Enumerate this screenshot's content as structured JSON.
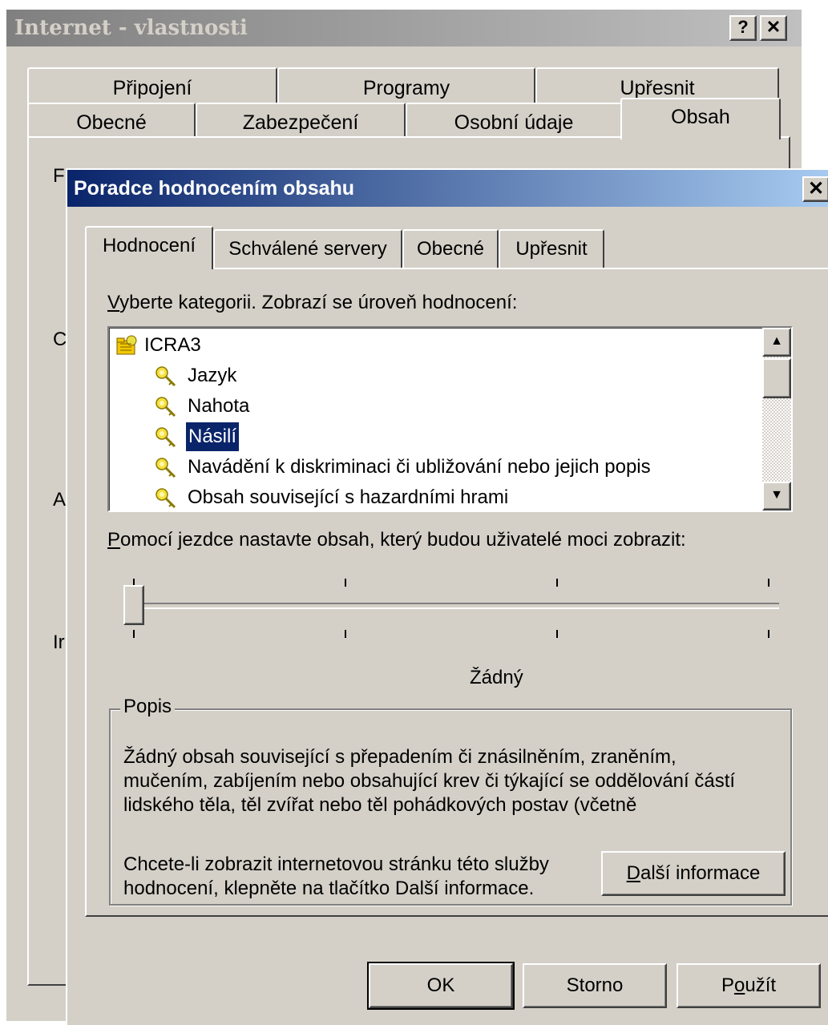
{
  "back_window": {
    "title": "Internet - vlastnosti",
    "help_btn": "?",
    "close_btn": "✕",
    "tabs_row1": [
      "Připojení",
      "Programy",
      "Upřesnit"
    ],
    "tabs_row2": [
      "Obecné",
      "Zabezpečení",
      "Osobní údaje",
      "Obsah"
    ],
    "peek_letters": [
      "F",
      "C",
      "A",
      "Ir"
    ]
  },
  "dialog": {
    "title": "Poradce hodnocením obsahu",
    "close_btn": "✕",
    "tabs": [
      "Hodnocení",
      "Schválené servery",
      "Obecné",
      "Upřesnit"
    ],
    "category_label": "Vyberte kategorii. Zobrazí se úroveň hodnocení:",
    "category_label_underline": "V",
    "category_label_rest": "yberte kategorii. Zobrazí se úroveň hodnocení:",
    "tree": {
      "root": "ICRA3",
      "items": [
        "Jazyk",
        "Nahota",
        "Násilí",
        "Navádění k diskriminaci či ubližování nebo jejich popis",
        "Obsah související s hazardními hrami"
      ],
      "selected": "Násilí"
    },
    "slider_label_underline": "P",
    "slider_label_rest": "omocí jezdce nastavte obsah, který budou uživatelé moci zobrazit:",
    "slider_level": 0,
    "slider_steps": 4,
    "slider_value": "Žádný",
    "group": {
      "legend": "Popis",
      "description": "Žádný obsah související s přepadením či znásilněním, zraněním, mučením, zabíjením nebo obsahující krev či týkající se oddělování částí lidského těla, těl zvířat nebo těl pohádkových postav (včetně",
      "info_text": "Chcete-li zobrazit internetovou stránku této služby hodnocení, klepněte na tlačítko Další informace.",
      "info_button_underline": "D",
      "info_button_rest": "alší informace"
    },
    "buttons": {
      "ok": "OK",
      "cancel": "Storno",
      "apply_pre": "P",
      "apply_underline": "o",
      "apply_rest": "užít"
    }
  },
  "colors": {
    "face": "#d4d0c8",
    "active_title": "#0a246a",
    "inactive_title": "#808080",
    "selection": "#0a246a"
  }
}
